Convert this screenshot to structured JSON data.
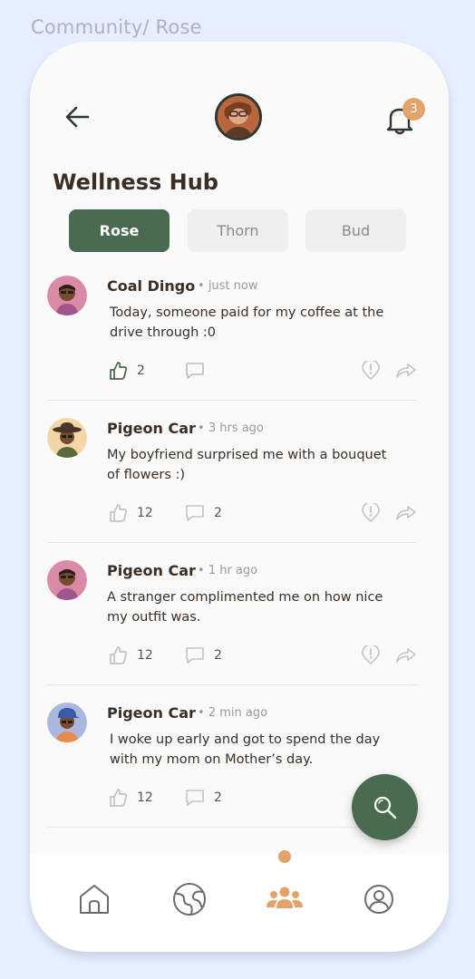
{
  "breadcrumb": "Community/ Rose",
  "header": {
    "notification_count": "3"
  },
  "page_title": "Wellness Hub",
  "tabs": [
    {
      "label": "Rose",
      "active": true
    },
    {
      "label": "Thorn",
      "active": false
    },
    {
      "label": "Bud",
      "active": false
    }
  ],
  "posts": [
    {
      "name": "Coal Dingo",
      "time": "just now",
      "text": "Today, someone paid for my coffee at the drive through :0",
      "likes": "2",
      "comments": "",
      "liked": true
    },
    {
      "name": "Pigeon Car",
      "time": "3 hrs ago",
      "text": "My boyfriend surprised me with a bouquet of flowers :)",
      "likes": "12",
      "comments": "2",
      "liked": false
    },
    {
      "name": "Pigeon Car",
      "time": "1 hr ago",
      "text": "A stranger complimented me on how nice my outfit was.",
      "likes": "12",
      "comments": "2",
      "liked": false
    },
    {
      "name": "Pigeon Car",
      "time": "2 min ago",
      "text": "I woke up early and got to spend the day with my mom on Mother’s day.",
      "likes": "12",
      "comments": "2",
      "liked": false
    }
  ],
  "colors": {
    "accent": "#4a6b50",
    "badge": "#e3a46c",
    "background": "#e6efff"
  },
  "bottom_nav": {
    "items": [
      "home-icon",
      "globe-icon",
      "community-icon",
      "profile-icon"
    ],
    "active": "community-icon"
  }
}
